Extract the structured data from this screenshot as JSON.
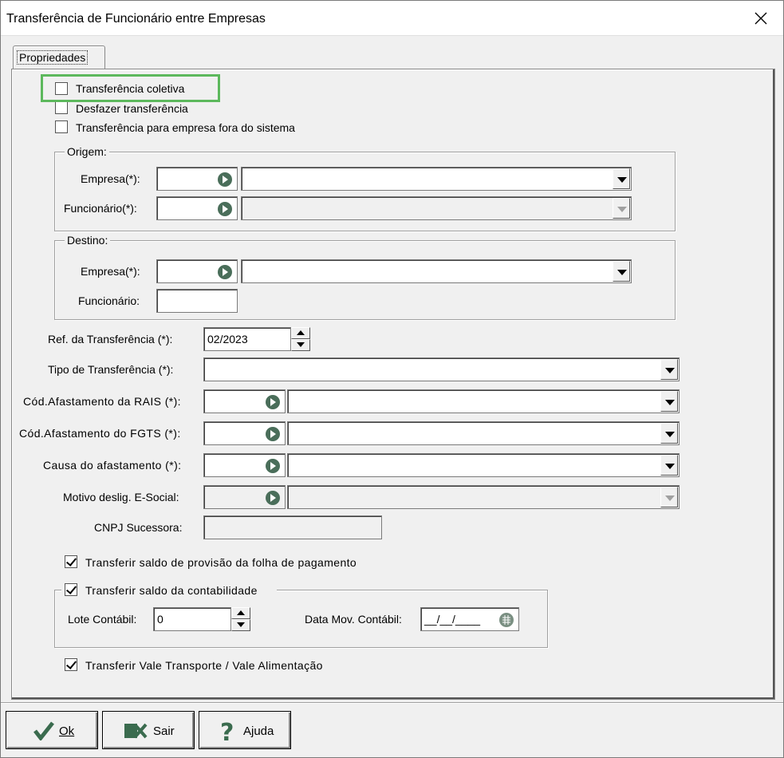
{
  "window": {
    "title": "Transferência de Funcionário entre Empresas"
  },
  "tabs": [
    {
      "label": "Propriedades"
    }
  ],
  "options": {
    "coletiva": {
      "label": "Transferência coletiva",
      "checked": false
    },
    "desfazer": {
      "label": "Desfazer transferência",
      "checked": false
    },
    "fora": {
      "label": "Transferência para empresa fora do sistema",
      "checked": false
    }
  },
  "origem": {
    "title": "Origem:",
    "empresa_label": "Empresa(*):",
    "funcionario_label": "Funcionário(*):"
  },
  "destino": {
    "title": "Destino:",
    "empresa_label": "Empresa(*):",
    "funcionario_label": "Funcionário:"
  },
  "ref": {
    "label": "Ref. da Transferência (*):",
    "value": "02/2023"
  },
  "tipo": {
    "label": "Tipo de Transferência (*):"
  },
  "rais": {
    "label": "Cód.Afastamento da RAIS (*):"
  },
  "fgts": {
    "label": "Cód.Afastamento do FGTS (*):"
  },
  "causa": {
    "label": "Causa do afastamento (*):"
  },
  "motivo": {
    "label": "Motivo deslig. E-Social:"
  },
  "cnpj": {
    "label": "CNPJ Sucessora:"
  },
  "provisao": {
    "label": "Transferir saldo de provisão da folha de pagamento",
    "checked": true
  },
  "contabilidade": {
    "label": "Transferir saldo da contabilidade",
    "checked": true,
    "lote_label": "Lote Contábil:",
    "lote_value": "0",
    "data_label": "Data Mov. Contábil:",
    "data_value": "__/__/____"
  },
  "vale": {
    "label": "Transferir Vale Transporte / Vale Alimentação",
    "checked": true
  },
  "buttons": {
    "ok": "Ok",
    "sair": "Sair",
    "ajuda": "Ajuda"
  },
  "colors": {
    "highlight": "#5cb85c"
  }
}
